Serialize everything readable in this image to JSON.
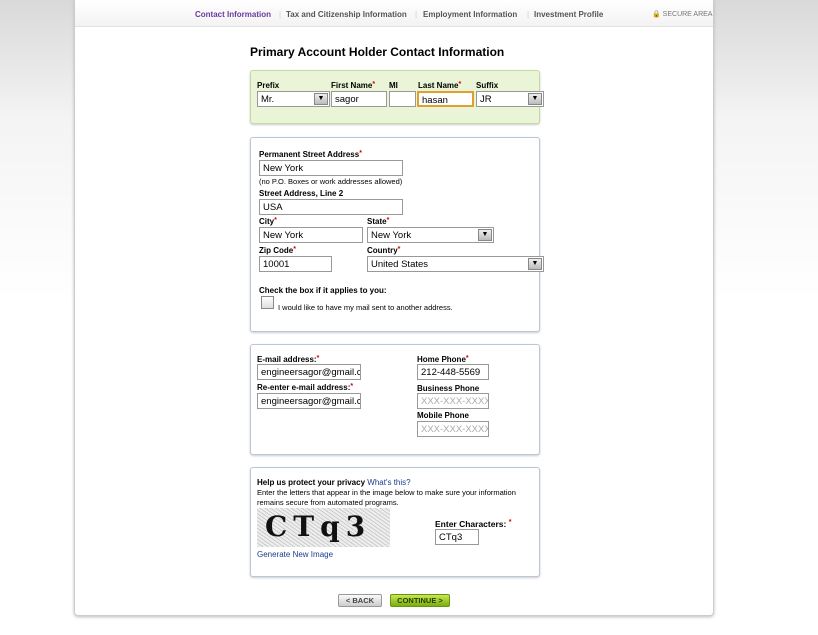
{
  "nav": {
    "tabs": [
      "Contact Information",
      "Tax and Citizenship Information",
      "Employment Information",
      "Investment Profile"
    ],
    "secure": "SECURE AREA"
  },
  "title": "Primary Account Holder Contact Information",
  "name": {
    "prefix_label": "Prefix",
    "prefix": "Mr.",
    "first_label": "First Name",
    "first": "sagor",
    "mi_label": "MI",
    "mi": "",
    "last_label": "Last Name",
    "last": "hasan",
    "suffix_label": "Suffix",
    "suffix": "JR"
  },
  "address": {
    "street_label": "Permanent Street Address",
    "street": "New York",
    "street_note": "(no P.O. Boxes or work addresses allowed)",
    "line2_label": "Street Address, Line 2",
    "line2": "USA",
    "city_label": "City",
    "city": "New York",
    "state_label": "State",
    "state": "New York",
    "zip_label": "Zip Code",
    "zip": "10001",
    "country_label": "Country",
    "country": "United States",
    "check_heading": "Check the box if it applies to you:",
    "check_label": "I would like to have my mail sent to another address."
  },
  "contact": {
    "email_label": "E-mail address:",
    "email": "engineersagor@gmail.co",
    "email2_label": "Re-enter e-mail address:",
    "email2": "engineersagor@gmail.co",
    "home_label": "Home Phone",
    "home": "212-448-5569",
    "business_label": "Business Phone",
    "business_placeholder": "XXX-XXX-XXXX",
    "mobile_label": "Mobile Phone",
    "mobile_placeholder": "XXX-XXX-XXXX"
  },
  "captcha": {
    "heading": "Help us protect your privacy",
    "whats_this": "What's this?",
    "instructions": "Enter the letters that appear in the image below to make sure your information remains secure from automated programs.",
    "image_text": "CTq3",
    "enter_label": "Enter Characters:",
    "value": "CTq3",
    "regen": "Generate New Image"
  },
  "buttons": {
    "back": "< BACK",
    "continue": "CONTINUE >"
  },
  "required_mark": "*"
}
